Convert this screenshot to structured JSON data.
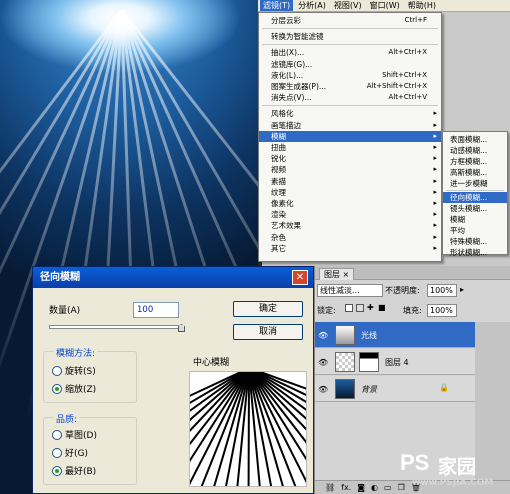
{
  "menubar": {
    "items": [
      "滤镜(T)",
      "分析(A)",
      "视图(V)",
      "窗口(W)",
      "帮助(H)"
    ],
    "active_index": 0
  },
  "filter_menu": {
    "items": [
      {
        "label": "分层云彩",
        "shortcut": "Ctrl+F"
      },
      {
        "label": "转换为智能滤镜",
        "shortcut": ""
      },
      {
        "label": "抽出(X)...",
        "shortcut": "Alt+Ctrl+X"
      },
      {
        "label": "滤镜库(G)...",
        "shortcut": ""
      },
      {
        "label": "液化(L)...",
        "shortcut": "Shift+Ctrl+X"
      },
      {
        "label": "图案生成器(P)...",
        "shortcut": "Alt+Shift+Ctrl+X"
      },
      {
        "label": "消失点(V)...",
        "shortcut": "Alt+Ctrl+V"
      },
      {
        "label": "风格化",
        "shortcut": ""
      },
      {
        "label": "画笔描边",
        "shortcut": ""
      },
      {
        "label": "模糊",
        "shortcut": ""
      },
      {
        "label": "扭曲",
        "shortcut": ""
      },
      {
        "label": "锐化",
        "shortcut": ""
      },
      {
        "label": "视频",
        "shortcut": ""
      },
      {
        "label": "素描",
        "shortcut": ""
      },
      {
        "label": "纹理",
        "shortcut": ""
      },
      {
        "label": "像素化",
        "shortcut": ""
      },
      {
        "label": "渲染",
        "shortcut": ""
      },
      {
        "label": "艺术效果",
        "shortcut": ""
      },
      {
        "label": "杂色",
        "shortcut": ""
      },
      {
        "label": "其它",
        "shortcut": ""
      }
    ],
    "highlighted_index": 9
  },
  "blur_submenu": {
    "items": [
      "表面模糊...",
      "动感模糊...",
      "方框模糊...",
      "高斯模糊...",
      "进一步模糊",
      "径向模糊...",
      "镜头模糊...",
      "模糊",
      "平均",
      "特殊模糊...",
      "形状模糊..."
    ],
    "highlighted_index": 5
  },
  "dialog": {
    "title": "径向模糊",
    "close_symbol": "✕",
    "amount_label": "数量(A)",
    "amount_value": "100",
    "ok_label": "确定",
    "cancel_label": "取消",
    "method_legend": "模糊方法:",
    "method_options": [
      "旋转(S)",
      "缩放(Z)"
    ],
    "method_selected": 1,
    "quality_legend": "品质:",
    "quality_options": [
      "草图(D)",
      "好(G)",
      "最好(B)"
    ],
    "quality_selected": 2,
    "center_label": "中心模糊"
  },
  "layers_panel": {
    "tab_label": "图层",
    "tab_close": "×",
    "blend_mode": "线性减淡...",
    "opacity_label": "不透明度:",
    "opacity_value": "100%",
    "lock_label": "锁定:",
    "fill_label": "填充:",
    "fill_value": "100%",
    "layers": [
      {
        "name": "光线",
        "selected": true
      },
      {
        "name": "图层 4",
        "selected": false
      },
      {
        "name": "背景",
        "selected": false
      }
    ],
    "bottom_icons": [
      "link-icon",
      "fx-icon",
      "mask-icon",
      "adjust-icon",
      "folder-icon",
      "new-layer-icon",
      "trash-icon"
    ],
    "fx_label": "fx."
  },
  "watermark": {
    "brand": "PS",
    "suffix": "家园",
    "url": "www.PSJIA.COM"
  },
  "colors": {
    "highlight": "#316ac5",
    "dialog_title": "#0a4fc8",
    "canvas_blue": "#1d5d9e"
  }
}
